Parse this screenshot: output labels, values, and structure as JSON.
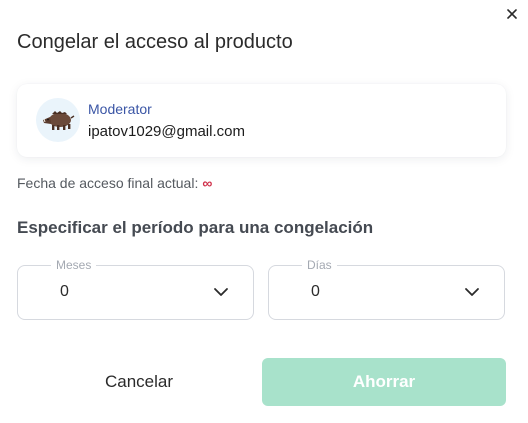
{
  "dialog": {
    "title": "Congelar el acceso al producto"
  },
  "user": {
    "role": "Moderator",
    "email": "ipatov1029@gmail.com",
    "avatar_icon": "boar-icon"
  },
  "access": {
    "label": "Fecha de acceso final actual:",
    "value": "∞",
    "value_color": "#d0304a"
  },
  "freeze": {
    "heading": "Especificar el período para una congelación",
    "months": {
      "label": "Meses",
      "value": "0"
    },
    "days": {
      "label": "Días",
      "value": "0"
    }
  },
  "actions": {
    "cancel_label": "Cancelar",
    "save_label": "Ahorrar",
    "save_color": "#a8e2cb"
  }
}
